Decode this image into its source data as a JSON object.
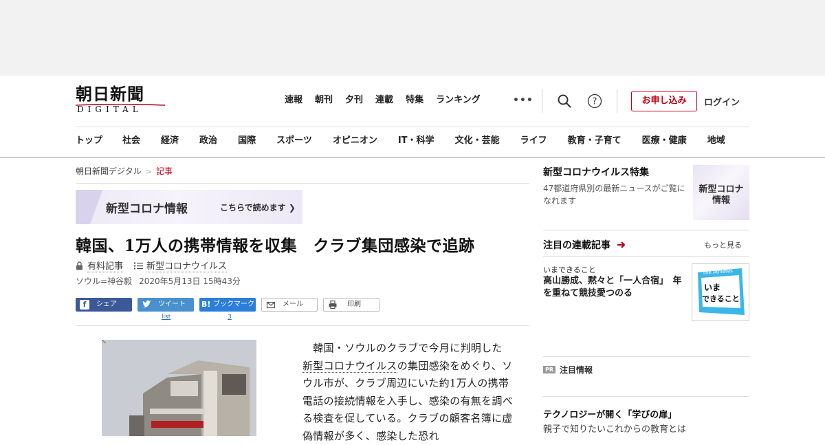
{
  "header": {
    "logo_top": "朝日新聞",
    "logo_bottom": "DIGITAL",
    "top_links": [
      "速報",
      "朝刊",
      "夕刊",
      "連載",
      "特集",
      "ランキング"
    ],
    "more": "•••",
    "apply_button": "お申し込み",
    "login": "ログイン",
    "accent": "#c00018"
  },
  "nav": [
    "トップ",
    "社会",
    "経済",
    "政治",
    "国際",
    "スポーツ",
    "オピニオン",
    "IT・科学",
    "文化・芸能",
    "ライフ",
    "教育・子育て",
    "医療・健康",
    "地域"
  ],
  "breadcrumb": {
    "home": "朝日新聞デジタル",
    "sep": ">",
    "current": "記事"
  },
  "banner": {
    "left": "新型コロナ情報",
    "right": "こちらで読めます ❯"
  },
  "article": {
    "headline": "韓国、1万人の携帯情報を収集　クラブ集団感染で追跡",
    "premium": "有料記事",
    "topic": "新型コロナウイルス",
    "byline": "ソウル=神谷毅",
    "date": "2020年5月13日 15時43分",
    "share": {
      "facebook": "シェア",
      "twitter": "ツイート",
      "twitter_count": "list",
      "hatena": "ブックマーク",
      "hatena_count": "3",
      "mail": "メール",
      "print": "印刷"
    },
    "body_pre": "　韓国・ソウルのクラブで今月に判明した",
    "body_link": "新型コロナウイルス",
    "body_post": "の集団感染をめぐり、ソウル市が、クラブ周辺にいた約1万人の携帯電話の接続情報を入手し、感染の有無を調べる検査を促している。クラブの顧客名簿に虚偽情報が多く、感染した恐れ"
  },
  "sidebar": {
    "feature_title": "新型コロナウイルス特集",
    "feature_desc": "47都道府県別の最新ニュースがご覧になれます",
    "feature_thumb": "新型コロナ\n情報",
    "series_title": "注目の連載記事",
    "series_more": "もっと見る",
    "kicker": "いまできること",
    "article_title": "高山勝成、黙々と「一人合宿」　年を重ねて競技愛つのる",
    "athletes_small": "The Athletes",
    "athletes_big": "いま\nできること",
    "pr_tag": "PR",
    "pr_title": "注目情報",
    "tech_title": "テクノロジーが開く「学びの扉」",
    "tech_sub": "親子で知りたいこれからの教育とは"
  }
}
